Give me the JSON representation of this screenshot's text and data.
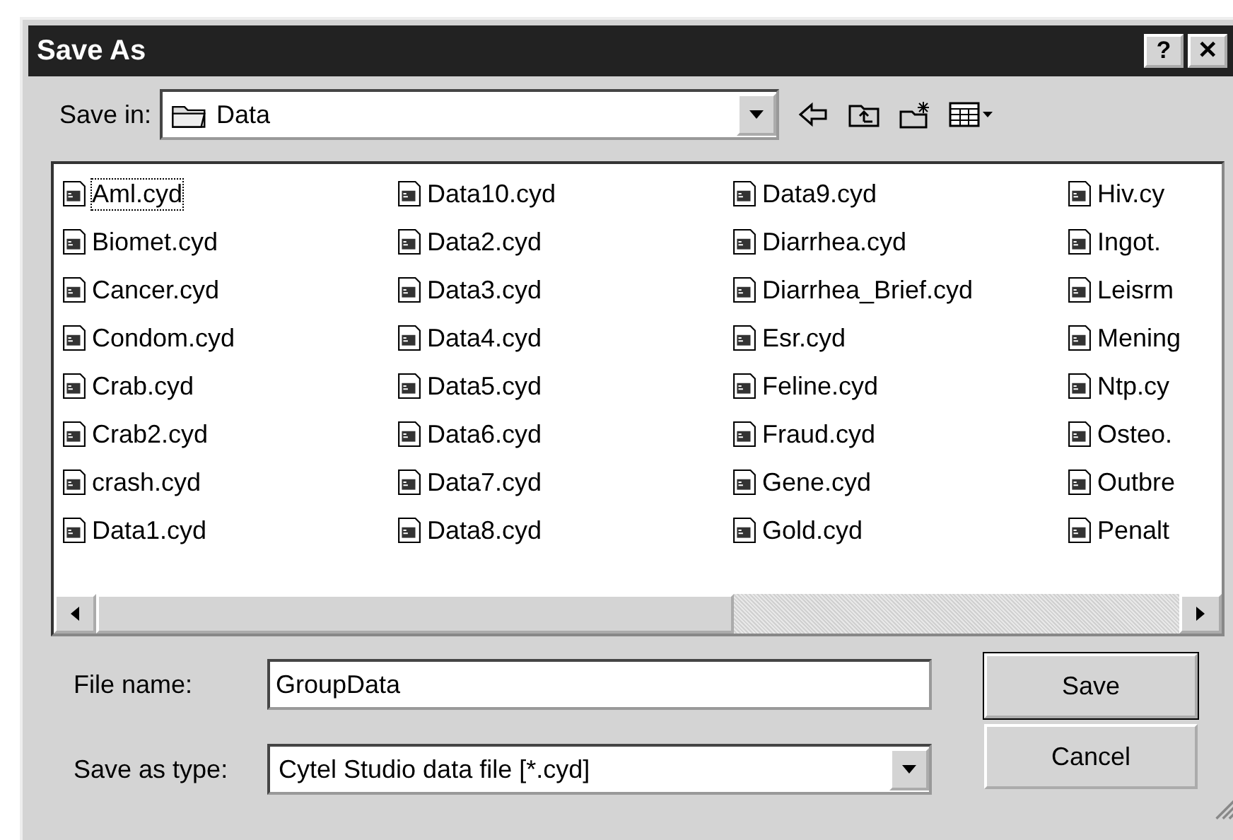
{
  "window": {
    "title": "Save As",
    "buttons": [
      "?",
      "✕"
    ]
  },
  "save_in": {
    "label": "Save in:",
    "value": "Data"
  },
  "files": [
    {
      "name": "Aml.cyd",
      "focused": true
    },
    {
      "name": "Biomet.cyd",
      "focused": false
    },
    {
      "name": "Cancer.cyd",
      "focused": false
    },
    {
      "name": "Condom.cyd",
      "focused": false
    },
    {
      "name": "Crab.cyd",
      "focused": false
    },
    {
      "name": "Crab2.cyd",
      "focused": false
    },
    {
      "name": "crash.cyd",
      "focused": false
    },
    {
      "name": "Data1.cyd",
      "focused": false
    },
    {
      "name": "Data10.cyd",
      "focused": false
    },
    {
      "name": "Data2.cyd",
      "focused": false
    },
    {
      "name": "Data3.cyd",
      "focused": false
    },
    {
      "name": "Data4.cyd",
      "focused": false
    },
    {
      "name": "Data5.cyd",
      "focused": false
    },
    {
      "name": "Data6.cyd",
      "focused": false
    },
    {
      "name": "Data7.cyd",
      "focused": false
    },
    {
      "name": "Data8.cyd",
      "focused": false
    },
    {
      "name": "Data9.cyd",
      "focused": false
    },
    {
      "name": "Diarrhea.cyd",
      "focused": false
    },
    {
      "name": "Diarrhea_Brief.cyd",
      "focused": false
    },
    {
      "name": "Esr.cyd",
      "focused": false
    },
    {
      "name": "Feline.cyd",
      "focused": false
    },
    {
      "name": "Fraud.cyd",
      "focused": false
    },
    {
      "name": "Gene.cyd",
      "focused": false
    },
    {
      "name": "Gold.cyd",
      "focused": false
    },
    {
      "name": "Hiv.cy",
      "focused": false
    },
    {
      "name": "Ingot.",
      "focused": false
    },
    {
      "name": "Leisrm",
      "focused": false
    },
    {
      "name": "Mening",
      "focused": false
    },
    {
      "name": "Ntp.cy",
      "focused": false
    },
    {
      "name": "Osteo.",
      "focused": false
    },
    {
      "name": "Outbre",
      "focused": false
    },
    {
      "name": "Penalt",
      "focused": false
    }
  ],
  "file_name": {
    "label": "File name:",
    "value": "GroupData"
  },
  "save_as_type": {
    "label": "Save as type:",
    "value": "Cytel Studio data file [*.cyd]"
  },
  "buttons": [
    {
      "label": "Save",
      "default": true
    },
    {
      "label": "Cancel",
      "default": false
    }
  ]
}
